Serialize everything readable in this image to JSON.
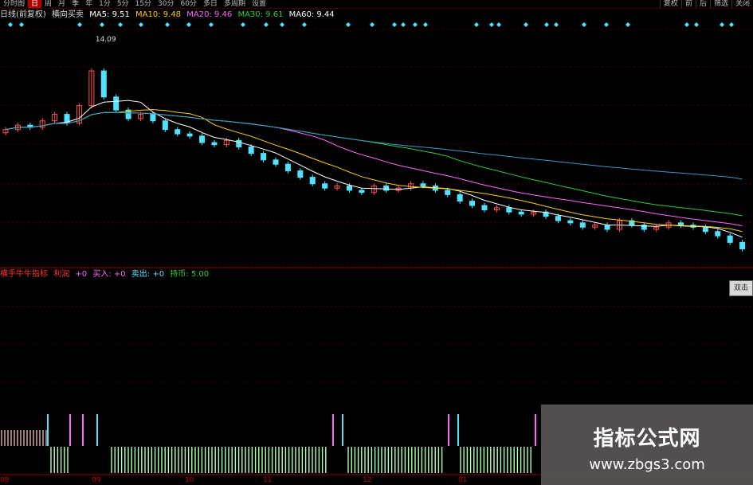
{
  "toolbar": {
    "left_tabs": [
      "分时图",
      "日",
      "周",
      "月",
      "季",
      "年",
      "1分",
      "5分",
      "15分",
      "30分",
      "60分",
      "多日",
      "多周期",
      "设置"
    ],
    "active_index": 1,
    "right_tabs": [
      "复权",
      "前",
      "后",
      "筛选",
      "关闭"
    ]
  },
  "ma_line": {
    "period_label": "日线(前复权)",
    "name": "横向买卖",
    "ma5": "MA5: 9.51",
    "ma10": "MA10: 9.48",
    "ma20": "MA20: 9.46",
    "ma30": "MA30: 9.61",
    "ma60": "MA60: 9.44"
  },
  "high_label": "14.09",
  "indicator_line": {
    "name": "横手牛牛指标",
    "profit": "利润",
    "profit_val": "+0",
    "buy": "买入: +0",
    "sell": "卖出: +0",
    "hold": "持币: 5.00"
  },
  "side_tip": "双击",
  "x_labels": [
    "08",
    "09",
    "10",
    "11",
    "12",
    "01"
  ],
  "watermark": {
    "title": "指标公式网",
    "url": "www.zbgs3.com"
  },
  "colors": {
    "up": "#ff4d4d",
    "down": "#4fe3ff",
    "ma5": "#ffffff",
    "ma10": "#ffcc00",
    "ma20": "#ff66ff",
    "ma30": "#33cc33",
    "ma60": "#3399cc",
    "grid": "#4a0000"
  },
  "chart_data": {
    "type": "candlestick",
    "x_labels": [
      "08",
      "09",
      "10",
      "11",
      "12",
      "01"
    ],
    "closes": [
      10.1,
      10.3,
      10.2,
      10.5,
      10.8,
      10.4,
      11.2,
      12.8,
      11.6,
      11.0,
      10.6,
      10.8,
      10.5,
      10.1,
      9.9,
      9.8,
      9.5,
      9.4,
      9.6,
      9.3,
      9.0,
      8.7,
      8.5,
      8.2,
      7.9,
      7.6,
      7.4,
      7.5,
      7.3,
      7.2,
      7.5,
      7.3,
      7.4,
      7.6,
      7.5,
      7.3,
      7.1,
      6.8,
      6.6,
      6.4,
      6.5,
      6.3,
      6.2,
      6.3,
      6.1,
      5.9,
      5.8,
      5.6,
      5.7,
      5.5,
      5.9,
      5.7,
      5.5,
      5.6,
      5.8,
      5.7,
      5.6,
      5.4,
      5.2,
      4.9,
      4.6
    ]
  }
}
